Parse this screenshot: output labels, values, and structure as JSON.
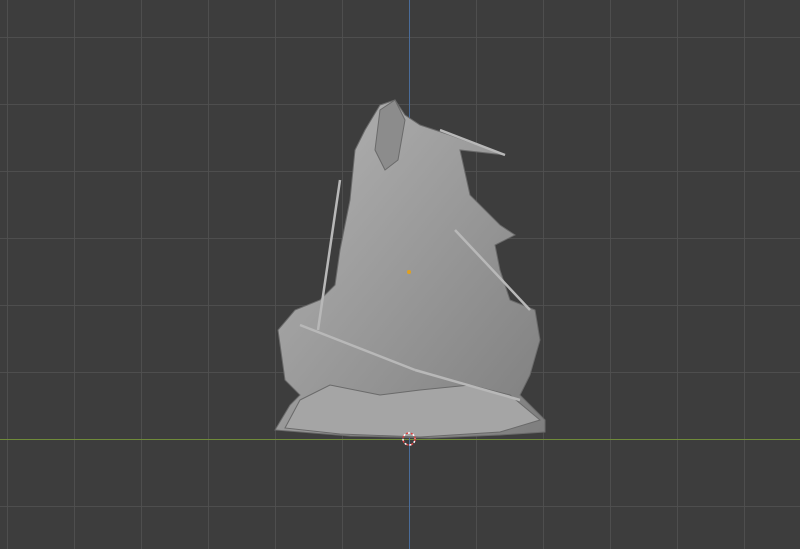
{
  "viewport": {
    "type": "blender-3d-viewport",
    "colors": {
      "background": "#3d3d3d",
      "grid": "#505050",
      "x_axis": "#6f8a3a",
      "y_axis": "#4a6c99",
      "model": "#9a9a9a"
    },
    "model": "sculpted-statue",
    "icons": {
      "origin": "object-origin-icon",
      "cursor": "3d-cursor-icon"
    }
  }
}
